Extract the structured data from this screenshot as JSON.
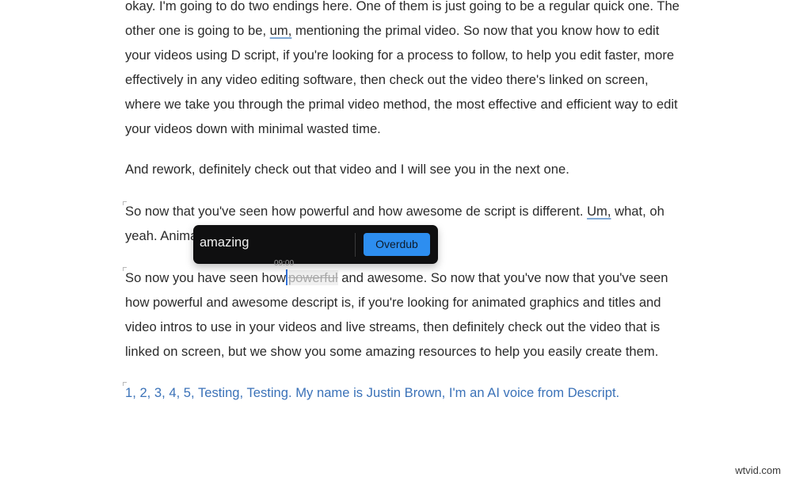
{
  "paragraphs": {
    "p1": {
      "l1": "okay. I'm going to do two endings here. One of them is just going to be a regular quick one. The",
      "l2a": "other one is going to be, ",
      "l2filler": "um,",
      "l2b": " mentioning the primal video. So now that you know how to edit",
      "l3": "your videos using D script, if you're looking for a process to follow, to help you edit faster, more",
      "l4": "effectively in any video editing software, then check out the video there's linked on screen,",
      "l5": "where we take you through the primal video method, the most effective and efficient way to edit",
      "l6": "your videos down with minimal wasted time."
    },
    "p2": {
      "l1": "And rework, definitely check out that video and I will see you in the next one."
    },
    "p3": {
      "l1a": "So now that you've seen how powerful and how awesome de script is different. ",
      "l1filler": "Um,",
      "l1b": " what, oh",
      "l2": "yeah. Animated"
    },
    "p4": {
      "l1a": "So now you have seen how",
      "l1struck": "powerful",
      "l1b": " and awesome. So now that you've now that you've seen",
      "l2": "how powerful and awesome descript is, if you're looking for animated graphics and titles and",
      "l3": "video intros to use in your videos and live streams, then definitely check out the video that is",
      "l4": "linked on screen, but we show you some amazing resources to help you easily create them."
    },
    "p5": {
      "l1": "1, 2, 3, 4, 5, Testing, Testing.  My name is Justin Brown, I'm an AI voice from Descript."
    }
  },
  "overdub_popover": {
    "input_value": "amazing",
    "button_label": "Overdub",
    "timestamp": "09:00"
  },
  "watermark": "wtvid.com",
  "colors": {
    "accent_blue": "#2d8ef0",
    "ai_voice_text": "#3b72b8",
    "popover_bg": "#0f0f10"
  }
}
